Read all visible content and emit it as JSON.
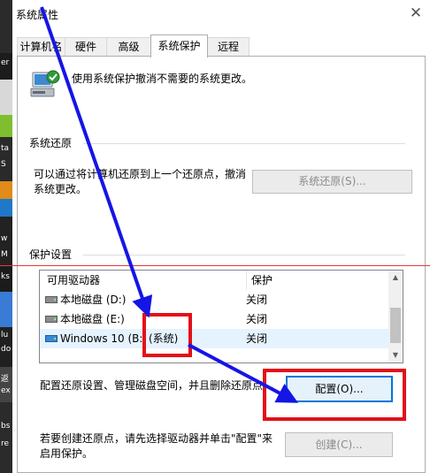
{
  "window": {
    "title": "系统属性",
    "close_glyph": "✕"
  },
  "tabs": [
    {
      "label": "计算机名",
      "active": false
    },
    {
      "label": "硬件",
      "active": false
    },
    {
      "label": "高级",
      "active": false
    },
    {
      "label": "系统保护",
      "active": true
    },
    {
      "label": "远程",
      "active": false
    }
  ],
  "header": {
    "text": "使用系统保护撤消不需要的系统更改。",
    "icon": "system-protection-icon"
  },
  "restore": {
    "section_title": "系统还原",
    "description": "可以通过将计算机还原到上一个还原点，撤消系统更改。",
    "button": "系统还原(S)..."
  },
  "protection": {
    "section_title": "保护设置",
    "columns": [
      "可用驱动器",
      "保护"
    ],
    "drives": [
      {
        "name": "本地磁盘 (D:)",
        "protection": "关闭",
        "icon": "drive-icon"
      },
      {
        "name": "本地磁盘 (E:)",
        "protection": "关闭",
        "icon": "drive-icon"
      },
      {
        "name": "Windows 10 (B:",
        "name_suffix": "(系统)",
        "protection": "关闭",
        "icon": "windows-drive-icon",
        "selected": true
      }
    ]
  },
  "configure": {
    "description": "配置还原设置、管理磁盘空间，并且删除还原点",
    "button": "配置(O)..."
  },
  "create": {
    "description": "若要创建还原点，请先选择驱动器并单击\"配置\"来启用保护。",
    "button": "创建(C)..."
  },
  "colors": {
    "annotation_red": "#e30f19",
    "annotation_blue": "#1515e6",
    "focus_blue": "#0078d7"
  },
  "left_strip": {
    "fragments": [
      "er",
      "ta",
      "S",
      "w",
      "M",
      "ks",
      "lu",
      "do",
      "返",
      "ex",
      "bs",
      "re"
    ]
  }
}
